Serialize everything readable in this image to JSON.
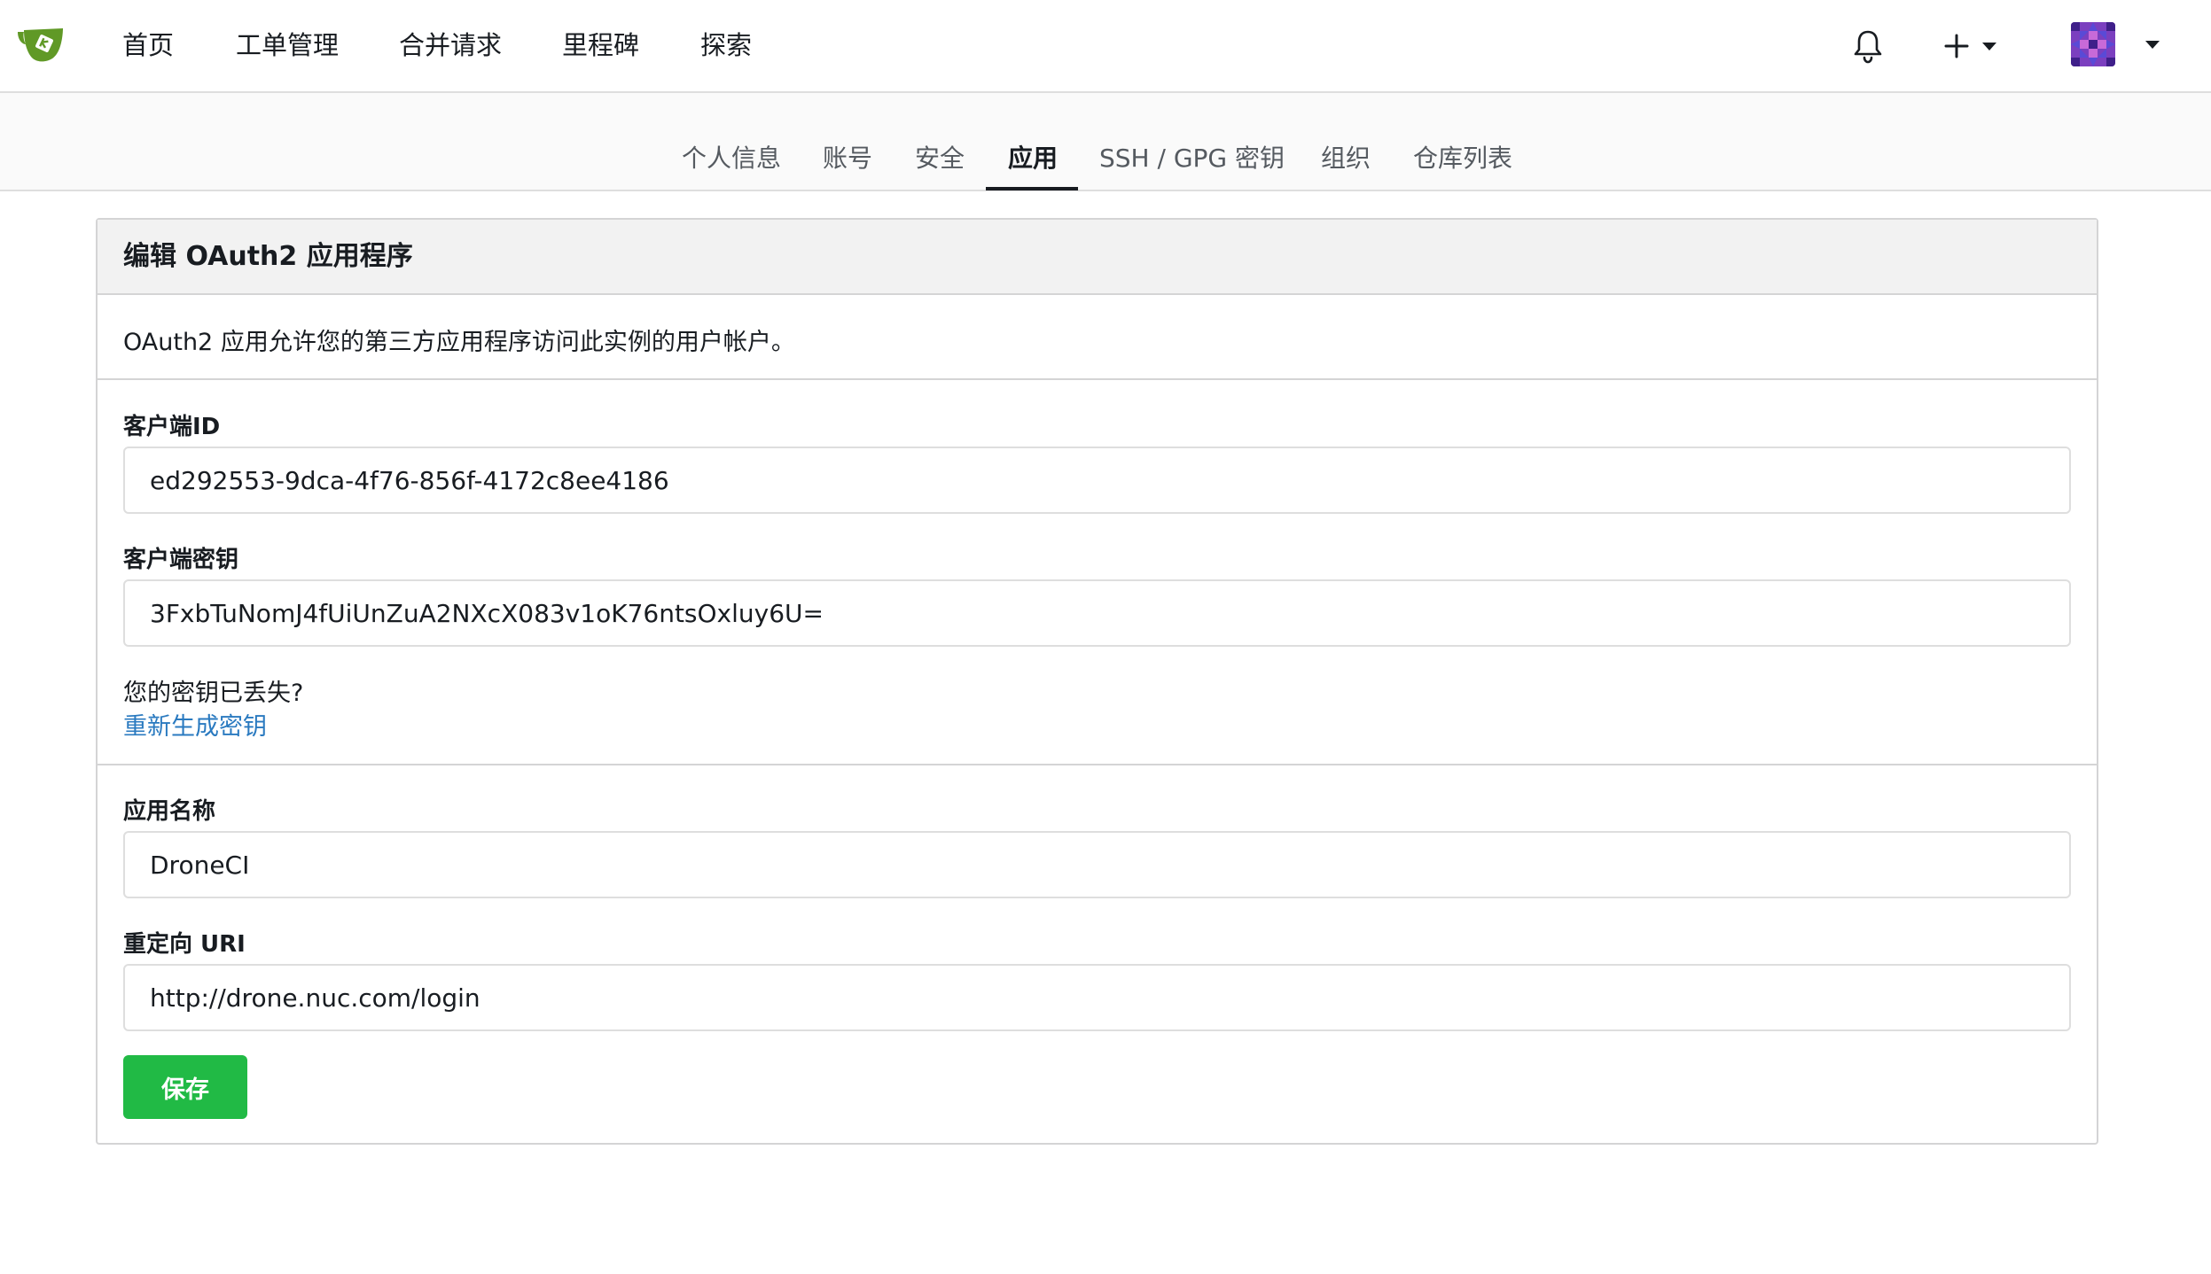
{
  "nav": {
    "items": [
      {
        "label": "首页"
      },
      {
        "label": "工单管理"
      },
      {
        "label": "合并请求"
      },
      {
        "label": "里程碑"
      },
      {
        "label": "探索"
      }
    ]
  },
  "settings_tabs": {
    "items": [
      {
        "label": "个人信息"
      },
      {
        "label": "账号"
      },
      {
        "label": "安全"
      },
      {
        "label": "应用"
      },
      {
        "label": "SSH / GPG 密钥"
      },
      {
        "label": "组织"
      },
      {
        "label": "仓库列表"
      }
    ],
    "active": "应用"
  },
  "panel": {
    "title": "编辑 OAuth2 应用程序",
    "description": "OAuth2 应用允许您的第三方应用程序访问此实例的用户帐户。",
    "client_id": {
      "label": "客户端ID",
      "value": "ed292553-9dca-4f76-856f-4172c8ee4186"
    },
    "client_secret": {
      "label": "客户端密钥",
      "value": "3FxbTuNomJ4fUiUnZuA2NXcX083v1oK76ntsOxluy6U="
    },
    "lost_secret_text": "您的密钥已丢失?",
    "regenerate_link": "重新生成密钥",
    "app_name": {
      "label": "应用名称",
      "value": "DroneCI"
    },
    "redirect_uri": {
      "label": "重定向 URI",
      "value": "http://drone.nuc.com/login"
    },
    "save_label": "保存"
  },
  "colors": {
    "primary_green": "#21ba45",
    "link_blue": "#2a7ac0",
    "logo_green": "#609926"
  },
  "icons": {
    "logo": "gitea-logo",
    "notifications": "bell-icon",
    "create": "plus-icon",
    "avatar": "avatar"
  }
}
